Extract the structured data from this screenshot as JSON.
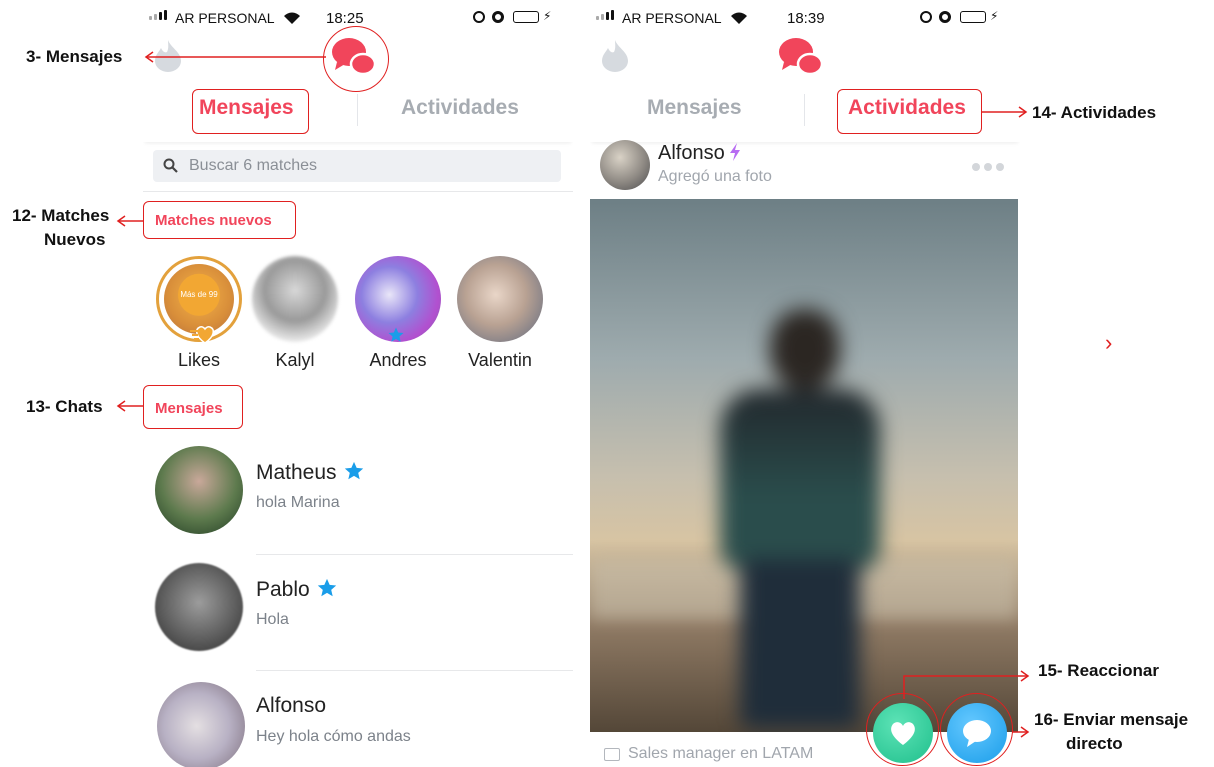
{
  "colors": {
    "brand": "#f1455b",
    "tab_inactive": "#a7acb2",
    "annotation": "#e02020",
    "star": "#1a9de9",
    "super": "#b86cf2"
  },
  "left_screen": {
    "status": {
      "carrier": "AR PERSONAL",
      "time": "18:25"
    },
    "tabs": [
      {
        "label": "Mensajes",
        "active": true
      },
      {
        "label": "Actividades",
        "active": false
      }
    ],
    "search": {
      "placeholder": "Buscar 6 matches"
    },
    "new_matches": {
      "label": "Matches nuevos",
      "likes_badge": "Más de 99",
      "items": [
        {
          "name": "Likes"
        },
        {
          "name": "Kalyl"
        },
        {
          "name": "Andres"
        },
        {
          "name": "Valentin"
        }
      ]
    },
    "messages": {
      "label": "Mensajes",
      "chats": [
        {
          "name": "Matheus",
          "preview": "hola Marina",
          "star": true
        },
        {
          "name": "Pablo",
          "preview": "Hola",
          "star": true
        },
        {
          "name": "Alfonso",
          "preview": "Hey hola cómo andas",
          "star": false
        }
      ]
    }
  },
  "right_screen": {
    "status": {
      "carrier": "AR PERSONAL",
      "time": "18:39"
    },
    "tabs": [
      {
        "label": "Mensajes",
        "active": false
      },
      {
        "label": "Actividades",
        "active": true
      }
    ],
    "post": {
      "author": "Alfonso",
      "action": "Agregó una foto",
      "footer": "Sales manager en LATAM"
    }
  },
  "annotations": {
    "mensajes": "3- Mensajes",
    "matches_nuevos_1": "12- Matches",
    "matches_nuevos_2": "Nuevos",
    "chats": "13- Chats",
    "actividades": "14- Actividades",
    "reaccionar": "15- Reaccionar",
    "enviar_1": "16- Enviar mensaje",
    "enviar_2": "directo"
  },
  "icons": [
    "signal-icon",
    "wifi-icon",
    "alarm-icon",
    "battery-icon",
    "flame-icon",
    "chat-logo-icon",
    "search-icon",
    "star-icon",
    "heart-icon",
    "chat-bubble-icon",
    "bolt-icon",
    "more-icon",
    "briefcase-icon",
    "chevron-right-icon"
  ]
}
